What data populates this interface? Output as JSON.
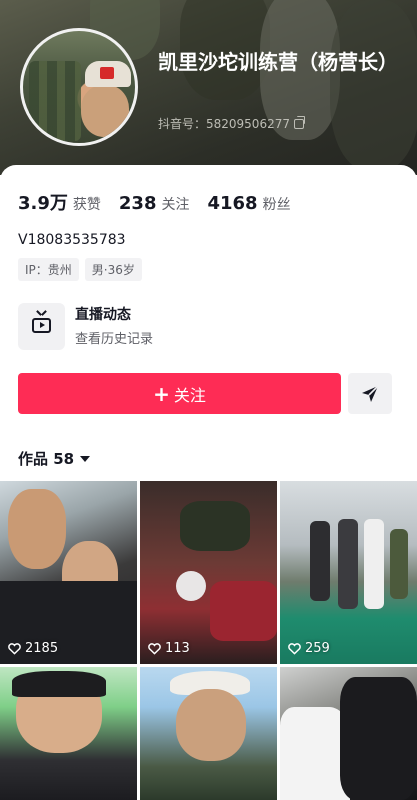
{
  "profile": {
    "name": "凯里沙坨训练营（杨营长）",
    "douyin_id": "抖音号：58209506277",
    "bio": "V18083535783",
    "tags": [
      "IP：贵州",
      "男·36岁"
    ]
  },
  "stats": [
    {
      "num": "3.9万",
      "label": "获赞"
    },
    {
      "num": "238",
      "label": "关注"
    },
    {
      "num": "4168",
      "label": "粉丝"
    }
  ],
  "live": {
    "title": "直播动态",
    "subtitle": "查看历史记录",
    "icon": "tv-icon"
  },
  "actions": {
    "follow_label": "关注",
    "share_icon": "send-icon"
  },
  "works": {
    "label": "作品 58"
  },
  "videos": [
    {
      "likes": "2185"
    },
    {
      "likes": "113"
    },
    {
      "likes": "259"
    },
    {
      "likes": ""
    },
    {
      "likes": ""
    },
    {
      "likes": ""
    }
  ],
  "colors": {
    "accent": "#fe2c55",
    "text": "#161823",
    "secondary": "#5f6067"
  }
}
